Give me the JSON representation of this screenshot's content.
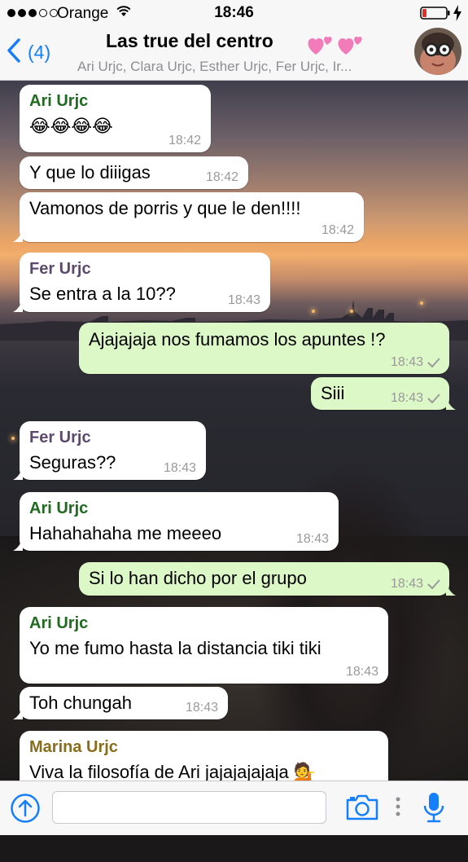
{
  "status_bar": {
    "carrier": "Orange",
    "time": "18:46"
  },
  "header": {
    "back_count": "(4)",
    "title": "Las true del centro",
    "members": "Ari Urjc, Clara Urjc, Esther Urjc, Fer Urjc, Ir..."
  },
  "messages": [
    {
      "direction": "in",
      "sender": "Ari Urjc",
      "text": "😂😂😂😂",
      "time": "18:42"
    },
    {
      "direction": "in",
      "sender": "",
      "text": "Y que lo diiigas",
      "time": "18:42"
    },
    {
      "direction": "in",
      "sender": "",
      "text": "Vamonos de porris y que le den!!!!",
      "time": "18:42"
    },
    {
      "direction": "in",
      "sender": "Fer Urjc",
      "text": "Se entra a la 10??",
      "time": "18:43"
    },
    {
      "direction": "out",
      "sender": "",
      "text": "Ajajajaja nos fumamos los apuntes !?",
      "time": "18:43"
    },
    {
      "direction": "out",
      "sender": "",
      "text": "Siii",
      "time": "18:43"
    },
    {
      "direction": "in",
      "sender": "Fer Urjc",
      "text": "Seguras??",
      "time": "18:43"
    },
    {
      "direction": "in",
      "sender": "Ari Urjc",
      "text": "Hahahahaha me meeeo",
      "time": "18:43"
    },
    {
      "direction": "out",
      "sender": "",
      "text": "Si lo han dicho por el grupo",
      "time": "18:43"
    },
    {
      "direction": "in",
      "sender": "Ari Urjc",
      "text": "Yo me fumo hasta la distancia tiki tiki",
      "time": "18:43"
    },
    {
      "direction": "in",
      "sender": "",
      "text": "Toh chungah",
      "time": "18:43"
    },
    {
      "direction": "in",
      "sender": "Marina Urjc",
      "text": "Viva la filosofía de Ari jajajajajaja 💁",
      "time": ""
    }
  ],
  "input": {
    "placeholder": "",
    "value": ""
  },
  "colors": {
    "accent": "#157efb",
    "incoming_bubble": "#ffffff",
    "outgoing_bubble": "#dcf8c6",
    "sender_ari": "#1f6b1f",
    "sender_fer": "#5b4a6e",
    "sender_marina": "#8a6d1a",
    "check": "#9a9a9a"
  },
  "icons": {
    "back": "chevron-left-icon",
    "wifi": "wifi-icon",
    "battery": "battery-icon",
    "charging": "charging-bolt-icon",
    "hearts": "two-hearts-icon",
    "share": "share-arrow-icon",
    "camera": "camera-icon",
    "more": "more-dots-icon",
    "mic": "microphone-icon",
    "read": "check-icon"
  }
}
